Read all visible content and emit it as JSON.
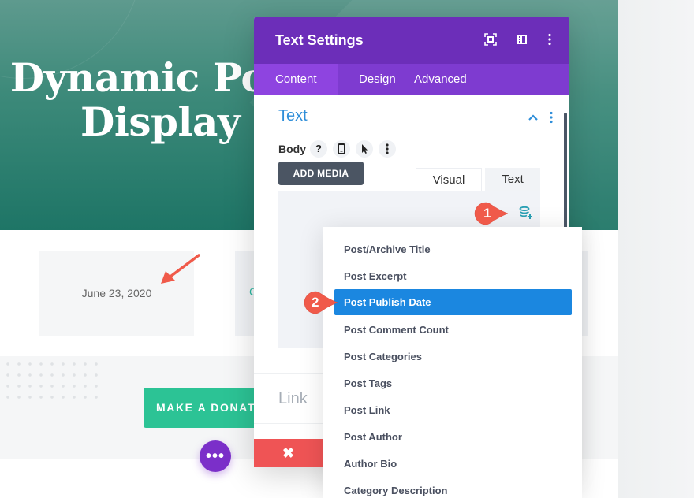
{
  "hero": {
    "title_line1": "r Dynamic Po",
    "title_line2": "Display I"
  },
  "content": {
    "date_card_text": "June 23, 2020",
    "second_card_glyph": "C",
    "donate_button": "MAKE A DONATI",
    "fab_label": "•••"
  },
  "modal": {
    "title": "Text Settings",
    "header_icons": [
      "fullscreen-icon",
      "split-view-icon",
      "more-options-icon"
    ],
    "tabs": [
      {
        "label": "Content",
        "active": true
      },
      {
        "label": "Design",
        "active": false
      },
      {
        "label": "Advanced",
        "active": false
      }
    ],
    "section_title": "Text",
    "field_label": "Body",
    "field_options": [
      "?",
      "",
      "",
      ""
    ],
    "add_media_label": "ADD MEDIA",
    "editor_tabs": [
      {
        "label": "Visual",
        "active": false
      },
      {
        "label": "Text",
        "active": true
      }
    ],
    "link_section": "Link",
    "close_label": "✖"
  },
  "dropdown": {
    "items": [
      {
        "label": "Post/Archive Title",
        "active": false
      },
      {
        "label": "Post Excerpt",
        "active": false
      },
      {
        "label": "Post Publish Date",
        "active": true
      },
      {
        "label": "Post Comment Count",
        "active": false
      },
      {
        "label": "Post Categories",
        "active": false
      },
      {
        "label": "Post Tags",
        "active": false
      },
      {
        "label": "Post Link",
        "active": false
      },
      {
        "label": "Post Author",
        "active": false
      },
      {
        "label": "Author Bio",
        "active": false
      },
      {
        "label": "Category Description",
        "active": false
      }
    ]
  },
  "annotations": {
    "step1": "1",
    "step2": "2",
    "accent_color": "#f05a4a"
  },
  "colors": {
    "modal_header": "#6c2eb9",
    "modal_tabs": "#7e3bd0",
    "active_item": "#1b87e0",
    "donate": "#2cc395",
    "close": "#ef5455",
    "section_title": "#2e8ed9"
  }
}
